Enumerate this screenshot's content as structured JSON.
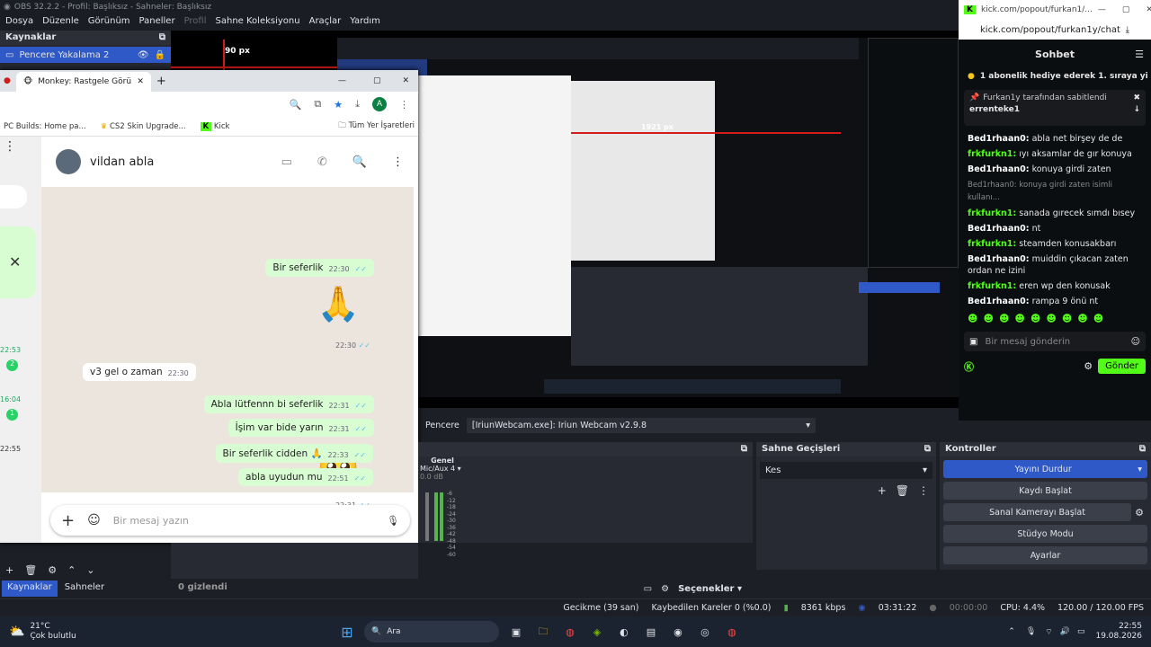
{
  "obs": {
    "title": "OBS 32.2.2 - Profil: Başlıksız - Sahneler: Başlıksız",
    "menu": [
      "Dosya",
      "Düzenle",
      "Görünüm",
      "Paneller",
      "Profil",
      "Sahne Koleksiyonu",
      "Araçlar",
      "Yardım"
    ],
    "sources_header": "Kaynaklar",
    "source_item": "Pencere Yakalama 2",
    "px_label": "90 px",
    "px_label2": "1921 px",
    "window_label": "Pencere",
    "window_value": "[IriunWebcam.exe]: Iriun Webcam v2.9.8",
    "audio_header": "Genel",
    "audio_track": "Mic/Aux 4",
    "audio_db": "0.0 dB",
    "audio_scale": [
      "-6",
      "-12",
      "-18",
      "-24",
      "-30",
      "-36",
      "-42",
      "-48",
      "-54",
      "-60"
    ],
    "transitions_header": "Sahne Geçişleri",
    "transition_value": "Kes",
    "controls_header": "Kontroller",
    "controls": {
      "stop_stream": "Yayını Durdur",
      "start_record": "Kaydı Başlat",
      "virtual_cam": "Sanal Kamerayı Başlat",
      "studio": "Stüdyo Modu",
      "settings": "Ayarlar"
    },
    "hidden_count": "0 gizlendi",
    "options": "Seçenekler",
    "tabs": {
      "sources": "Kaynaklar",
      "scenes": "Sahneler"
    },
    "status": {
      "delay": "Gecikme (39 san)",
      "dropped": "Kaybedilen Kareler 0 (%0.0)",
      "bitrate": "8361 kbps",
      "stream_time": "03:31:22",
      "record_time": "00:00:00",
      "cpu": "CPU: 4.4%",
      "fps": "120.00 / 120.00 FPS"
    }
  },
  "wa": {
    "tab_title": "Monkey: Rastgele Görüntü",
    "bookmarks": [
      "PC Builds: Home pa...",
      "CS2 Skin Upgrade...",
      "Kick",
      "Tüm Yer İşaretleri"
    ],
    "contact": "vildan abla",
    "side_times": [
      "22:53",
      "16:04",
      "22:55"
    ],
    "side_badges": [
      "2",
      "1"
    ],
    "messages": [
      {
        "text": "Bir seferlik",
        "time": "22:30",
        "dir": "out"
      },
      {
        "text": "🙏",
        "time": "22:30",
        "dir": "out"
      },
      {
        "text": "v3 gel o zaman",
        "time": "22:30",
        "dir": "in"
      },
      {
        "text": "Abla lütfennn bi seferlik",
        "time": "22:31",
        "dir": "out"
      },
      {
        "text": "İşim var bide yarın",
        "time": "22:31",
        "dir": "out"
      },
      {
        "text": "🥺",
        "time": "22:31",
        "dir": "out"
      },
      {
        "text": "Bir seferlik cidden 🙏",
        "time": "22:33",
        "dir": "out"
      },
      {
        "text": "abla uyudun mu",
        "time": "22:51",
        "dir": "out"
      }
    ],
    "input_placeholder": "Bir mesaj yazın"
  },
  "kick": {
    "url_short": "kick.com/popout/furkan1/...",
    "url": "kick.com/popout/furkan1y/chat",
    "title": "Sohbet",
    "gift_banner": "1 abonelik hediye ederek 1. sıraya yi",
    "pinned_by": "Furkan1y tarafından sabitlendi",
    "pinned_msg": "errenteke1",
    "lines": [
      {
        "user": "Bed1rhaan0:",
        "msg": "abla net birşey de de",
        "cls": "u1"
      },
      {
        "user": "frkfurkn1:",
        "msg": "ıyı aksamlar de gır konuya",
        "cls": "u2"
      },
      {
        "user": "Bed1rhaan0:",
        "msg": "konuya girdi zaten",
        "cls": "u1"
      },
      {
        "user": "",
        "msg": "Bed1rhaan0: konuya girdi zaten isimli kullanı...",
        "cls": "dim"
      },
      {
        "user": "frkfurkn1:",
        "msg": "sanada gırecek sımdı bısey",
        "cls": "u2"
      },
      {
        "user": "Bed1rhaan0:",
        "msg": "nt",
        "cls": "u1"
      },
      {
        "user": "frkfurkn1:",
        "msg": "steamden konusakbarı",
        "cls": "u2"
      },
      {
        "user": "Bed1rhaan0:",
        "msg": "muiddin çıkacan zaten ordan ne izini",
        "cls": "u1"
      },
      {
        "user": "frkfurkn1:",
        "msg": "eren wp den konusak",
        "cls": "u2"
      },
      {
        "user": "Bed1rhaan0:",
        "msg": "rampa 9 önü nt",
        "cls": "u1"
      }
    ],
    "input_placeholder": "Bir mesaj gönderin",
    "send": "Gönder"
  },
  "taskbar": {
    "temp": "21°C",
    "weather": "Çok bulutlu",
    "search": "Ara",
    "time": "22:55",
    "date": "19.08.2026"
  }
}
